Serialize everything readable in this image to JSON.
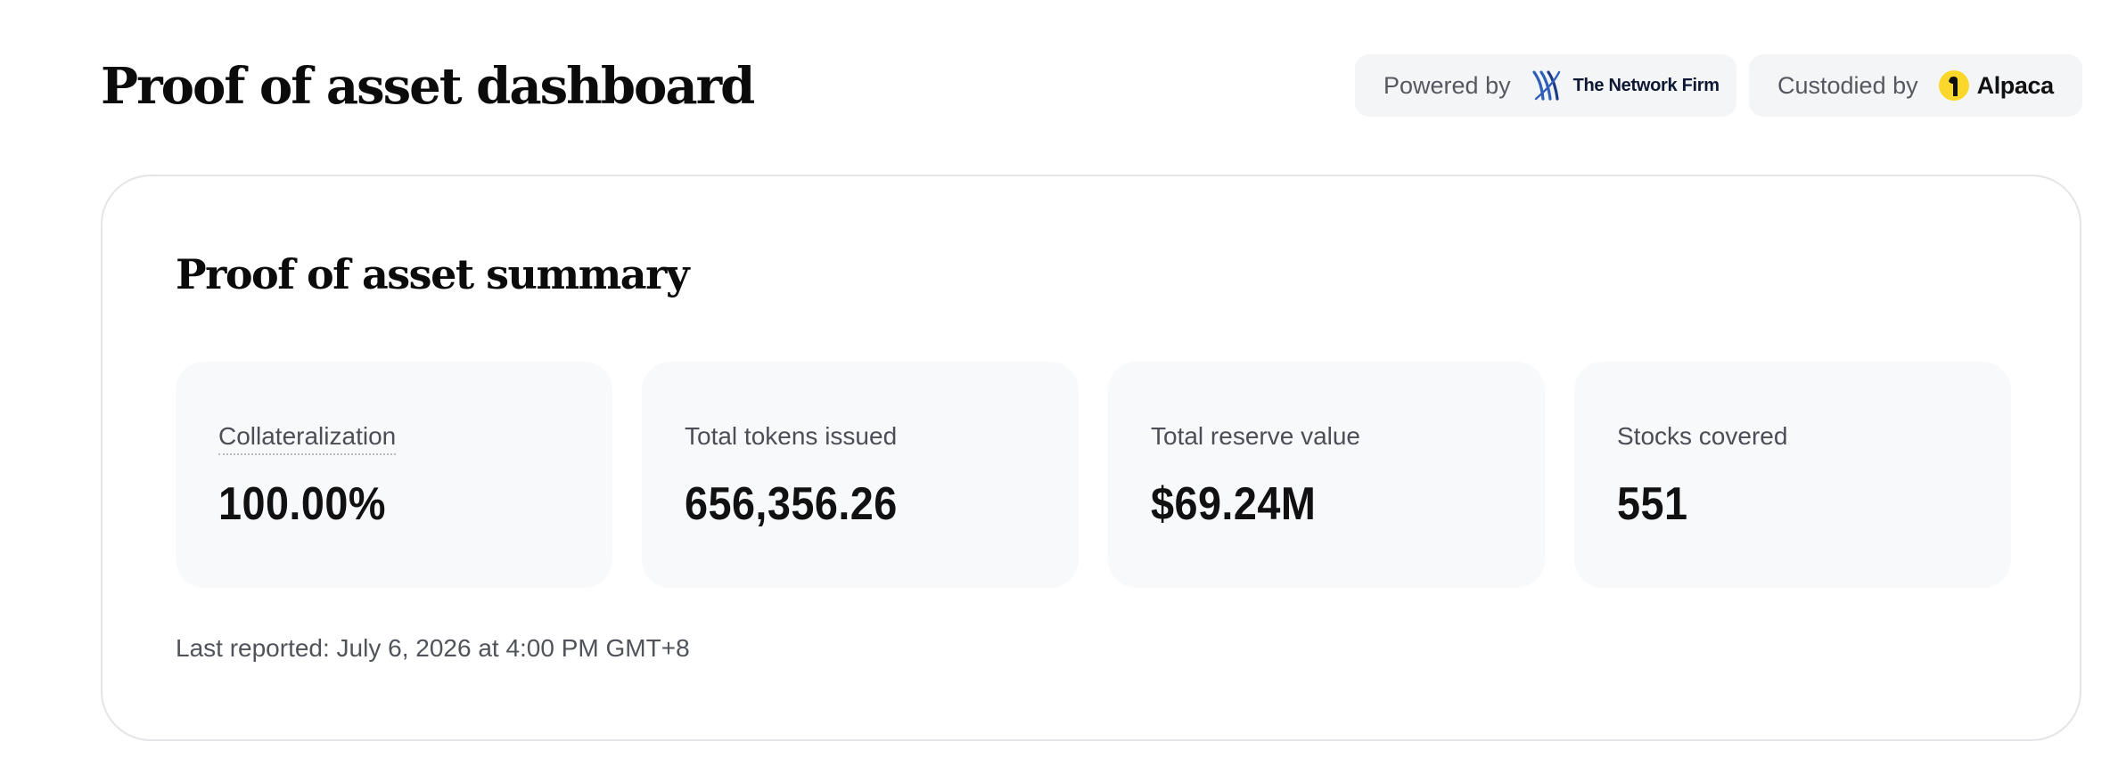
{
  "header": {
    "title": "Proof of asset dashboard",
    "powered_by": {
      "label": "Powered by",
      "brand_name": "The Network Firm",
      "logo_icon": "network-firm-logo-icon"
    },
    "custodied_by": {
      "label": "Custodied by",
      "brand_name": "Alpaca",
      "logo_icon": "alpaca-logo-icon"
    }
  },
  "summary": {
    "title": "Proof of asset summary",
    "stats": [
      {
        "label": "Collateralization",
        "value": "100.00%"
      },
      {
        "label": "Total tokens issued",
        "value": "656,356.26"
      },
      {
        "label": "Total reserve value",
        "value": "$69.24M"
      },
      {
        "label": "Stocks covered",
        "value": "551"
      }
    ],
    "last_reported": "Last reported: July 6, 2026 at 4:00 PM GMT+8"
  },
  "colors": {
    "network_firm_blue": "#2f5fb8",
    "alpaca_yellow": "#fcd72b",
    "card_background": "#f8f9fb",
    "pill_background": "#f4f5f7",
    "card_border": "#e4e5e8"
  }
}
